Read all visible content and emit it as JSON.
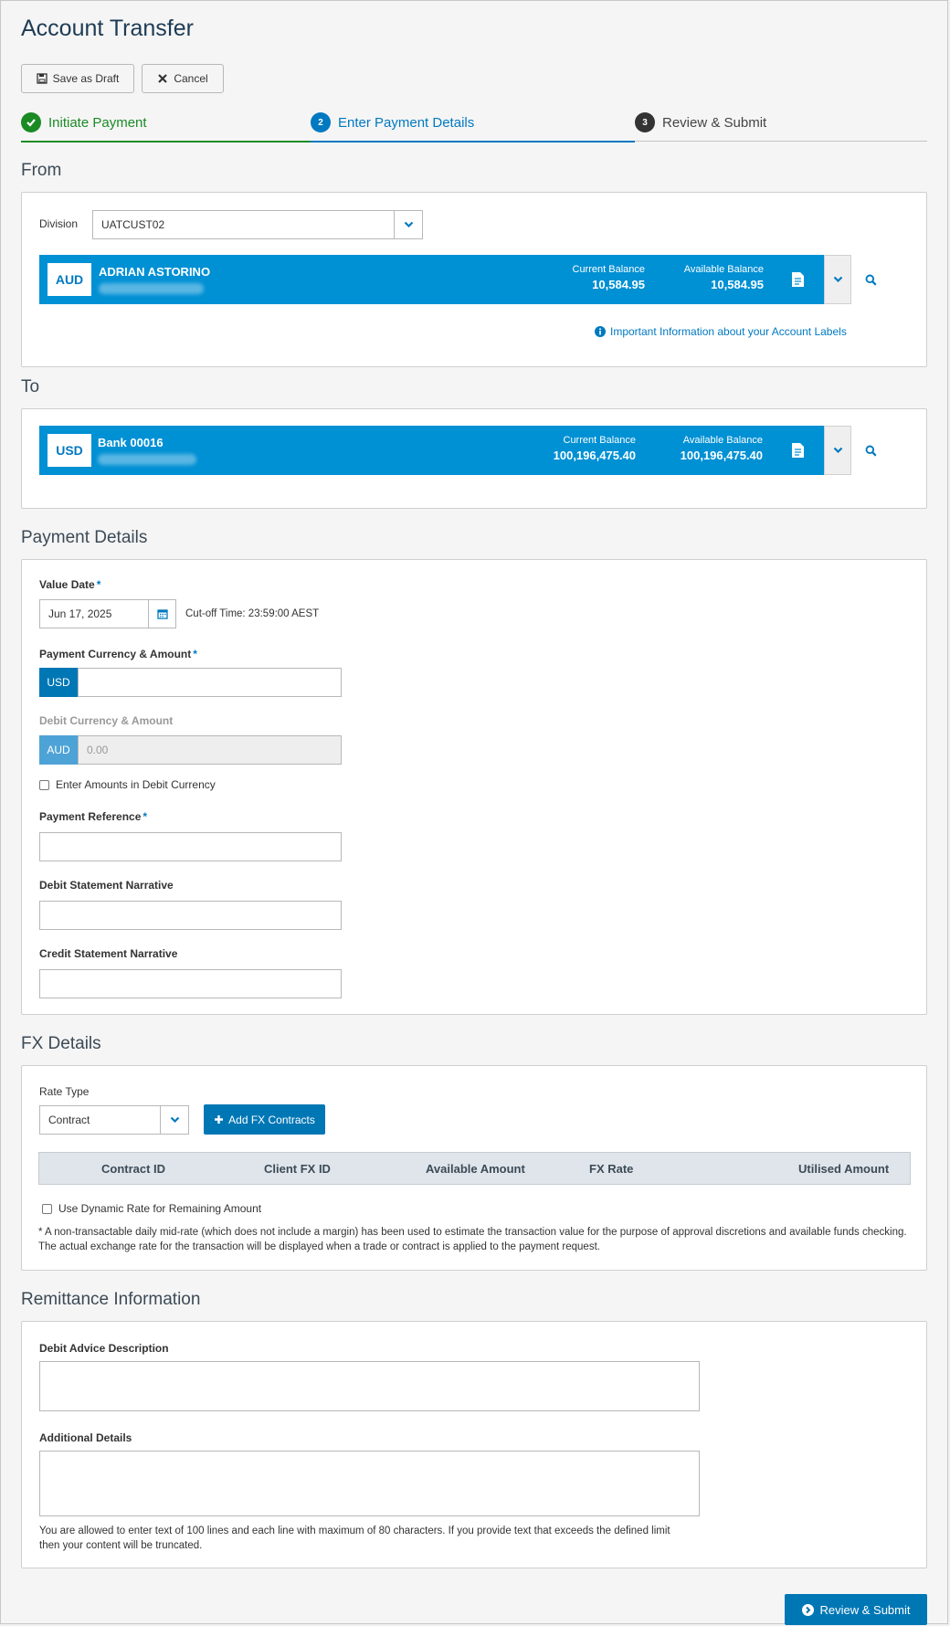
{
  "page": {
    "title": "Account Transfer"
  },
  "toolbar": {
    "save_draft": "Save as Draft",
    "cancel": "Cancel"
  },
  "steps": [
    {
      "num": "",
      "label": "Initiate Payment",
      "state": "done"
    },
    {
      "num": "2",
      "label": "Enter Payment Details",
      "state": "active"
    },
    {
      "num": "3",
      "label": "Review & Submit",
      "state": "pending"
    }
  ],
  "from": {
    "title": "From",
    "division_label": "Division",
    "division_value": "UATCUST02",
    "account": {
      "currency": "AUD",
      "name": "ADRIAN ASTORINO",
      "current_balance_label": "Current Balance",
      "current_balance": "10,584.95",
      "available_balance_label": "Available Balance",
      "available_balance": "10,584.95"
    },
    "info_link": "Important Information about your Account Labels"
  },
  "to": {
    "title": "To",
    "account": {
      "currency": "USD",
      "name": "Bank 00016",
      "current_balance_label": "Current Balance",
      "current_balance": "100,196,475.40",
      "available_balance_label": "Available Balance",
      "available_balance": "100,196,475.40"
    }
  },
  "payment": {
    "title": "Payment Details",
    "value_date_label": "Value Date",
    "value_date": "Jun 17, 2025",
    "cutoff": "Cut-off Time: 23:59:00 AEST",
    "pay_ccy_label": "Payment Currency & Amount",
    "pay_ccy": "USD",
    "debit_ccy_label": "Debit Currency & Amount",
    "debit_ccy": "AUD",
    "debit_amount_placeholder": "0.00",
    "enter_debit_checkbox": "Enter Amounts in Debit Currency",
    "reference_label": "Payment Reference",
    "debit_narrative_label": "Debit Statement Narrative",
    "credit_narrative_label": "Credit Statement Narrative"
  },
  "fx": {
    "title": "FX Details",
    "rate_type_label": "Rate Type",
    "rate_type": "Contract",
    "add_button": "Add FX Contracts",
    "columns": [
      "Contract ID",
      "Client FX ID",
      "Available Amount",
      "FX Rate",
      "Utilised Amount"
    ],
    "dynamic_checkbox": "Use Dynamic Rate for Remaining Amount",
    "note": "* A non-transactable daily mid-rate (which does not include a margin) has been used to estimate the transaction value for the purpose of approval discretions and available funds checking. The actual exchange rate for the transaction will be displayed when a trade or contract is applied to the payment request."
  },
  "remittance": {
    "title": "Remittance Information",
    "debit_advice_label": "Debit Advice Description",
    "additional_label": "Additional Details",
    "note": "You are allowed to enter text of 100 lines and each line with maximum of 80 characters. If you provide text that exceeds the defined limit then your content will be truncated."
  },
  "footer": {
    "submit": "Review & Submit"
  },
  "colors": {
    "primary": "#0077b5",
    "account_bar": "#0090d4",
    "success": "#1a8a24"
  }
}
